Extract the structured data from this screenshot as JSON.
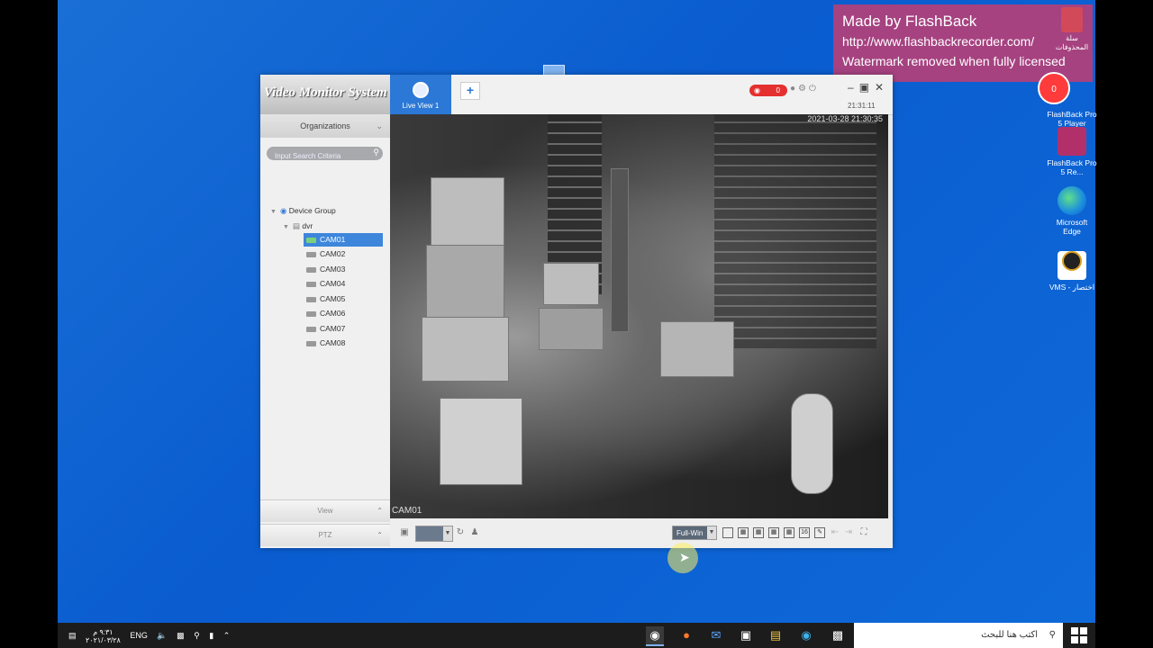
{
  "watermark": {
    "line1": "Made by FlashBack",
    "line2": "http://www.flashbackrecorder.com/",
    "line3": "Watermark removed when fully licensed"
  },
  "desktop_icons": [
    {
      "label": "FlashBack Pro 5 Player"
    },
    {
      "label": "FlashBack Pro 5 Re..."
    },
    {
      "label": "Microsoft Edge"
    },
    {
      "label": "VMS - اختصار"
    }
  ],
  "recycle_bin": {
    "label": "سلة المحذوفات"
  },
  "record_button": {
    "count": "0"
  },
  "app": {
    "logo": "Video Monitor System",
    "tab_label": "Live View 1",
    "add_tab": "+",
    "alarm_count": "0",
    "clock": "21:31:11",
    "sidebar": {
      "organizations": "Organizations",
      "search_placeholder": "Input Search Criteria",
      "device_group": "Device Group",
      "device": "dvr",
      "cameras": [
        "CAM01",
        "CAM02",
        "CAM03",
        "CAM04",
        "CAM05",
        "CAM06",
        "CAM07",
        "CAM08"
      ],
      "selected_camera": "CAM01",
      "view_label": "View",
      "ptz_label": "PTZ"
    },
    "video": {
      "timestamp": "2021-03-28 21:30:35",
      "camera_label": "CAM01"
    },
    "toolbar": {
      "window_mode": "Full-Win",
      "layout_16": "16"
    }
  },
  "taskbar": {
    "time": "٩:٣١ م",
    "date": "٢٠٢١/٠٣/٢٨",
    "language": "ENG",
    "search_placeholder": "اكتب هنا للبحث"
  }
}
